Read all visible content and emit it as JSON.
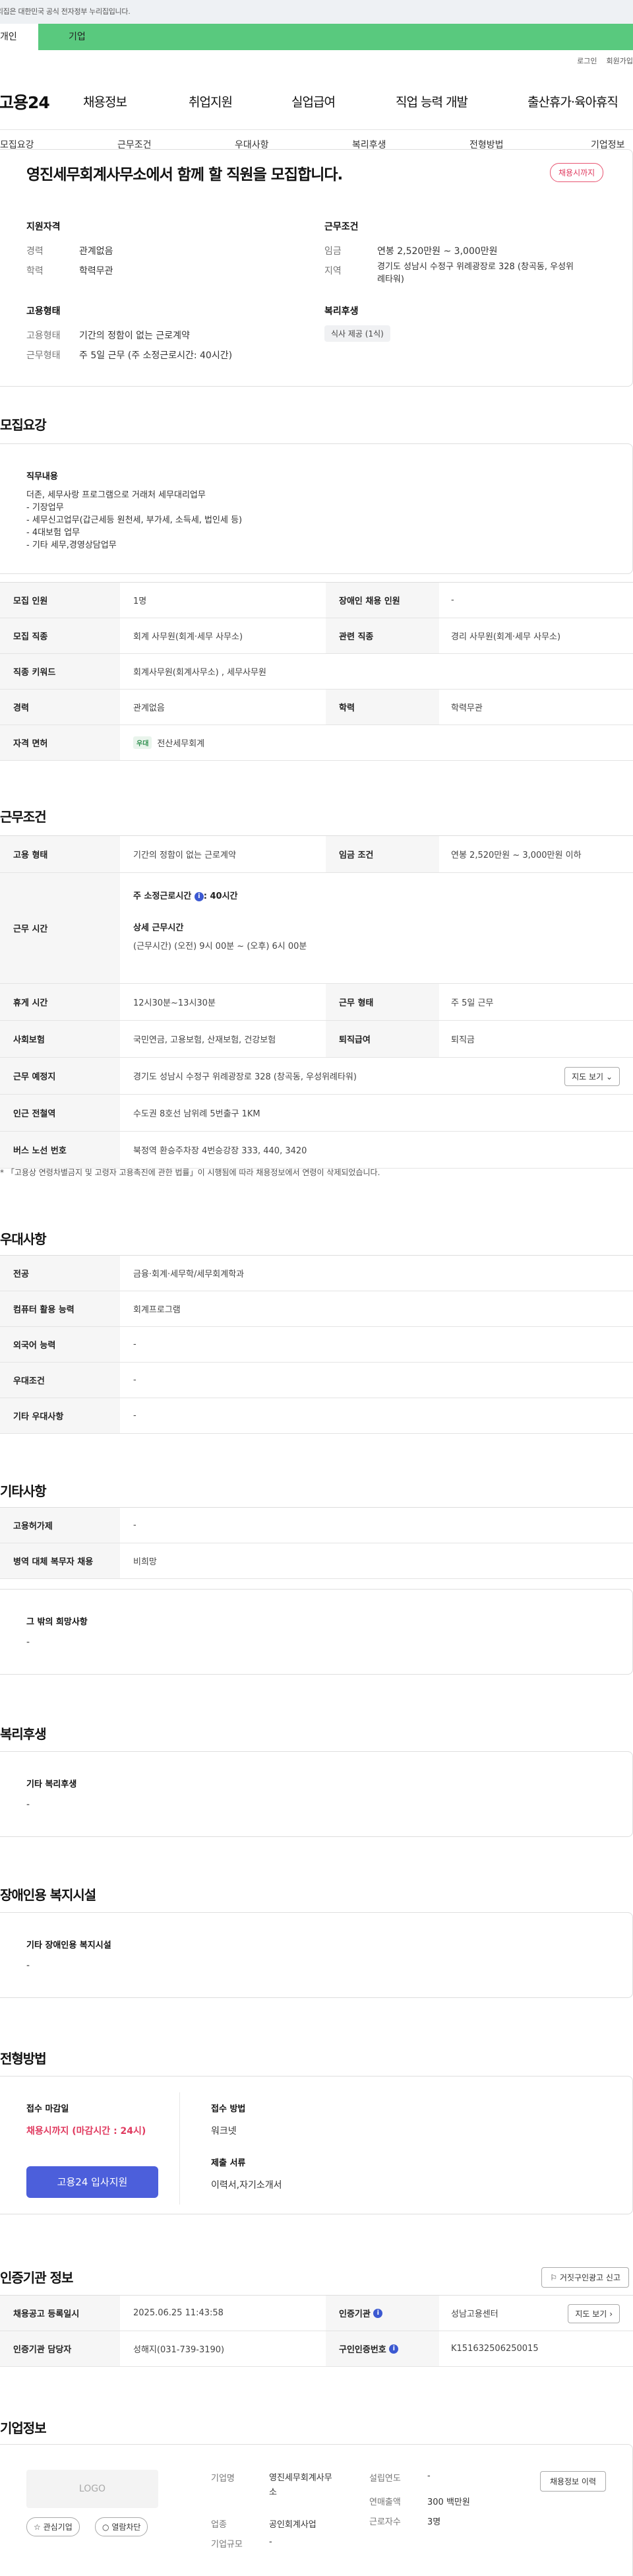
{
  "gov_banner": "이 누리집은 대한민국 공식 전자정부 누리집입니다.",
  "top_tabs": [
    "개인",
    "기업"
  ],
  "util": [
    "로그인",
    "회원가입"
  ],
  "logo": "고용24",
  "gnb": [
    "채용정보",
    "취업지원",
    "실업급여",
    "직업 능력 개발",
    "출산휴가·육아휴직"
  ],
  "secnav": [
    "모집요강",
    "근무조건",
    "우대사항",
    "복리후생",
    "전형방법",
    "기업정보"
  ],
  "summary": {
    "title": "영진세무회계사무소에서 함께 할 직원을 모집합니다.",
    "badge": "채용시까지",
    "qual_h": "지원자격",
    "exp_k": "경력",
    "exp_v": "관계없음",
    "edu_k": "학력",
    "edu_v": "학력무관",
    "emp_h": "고용형태",
    "emp_type_k": "고용형태",
    "emp_type_v": "기간의 정함이 없는 근로계약",
    "work_k": "근무형태",
    "work_v": "주 5일 근무 (주 소정근로시간: 40시간)",
    "cond_h": "근무조건",
    "wage_k": "임금",
    "wage_v": "연봉 2,520만원 ~ 3,000만원",
    "area_k": "지역",
    "area_v1": "경기도 성남시 수정구 위례광장로 328 (창곡동, 우성위",
    "area_v2": "례타워)",
    "welfare_h": "복리후생",
    "welfare_tag": "식사 제공 (1식)"
  },
  "req": {
    "title": "모집요강",
    "duty_h": "직무내용",
    "duty": [
      "더존, 세무사랑 프로그램으로 거래처 세무대리업무",
      "- 기장업무",
      "- 세무신고업무(갑근세등 원천세, 부가세, 소득세, 법인세 등)",
      "- 4대보험 업무",
      "- 기타 세무,경영상담업무"
    ],
    "rows": [
      {
        "k1": "모집 인원",
        "v1": "1명",
        "k2": "장애인 채용 인원",
        "v2": "-"
      },
      {
        "k1": "모집 직종",
        "v1": "회계 사무원(회계·세무 사무소)",
        "k2": "관련 직종",
        "v2": "경리 사무원(회계·세무 사무소)"
      },
      {
        "k1": "직종 키워드",
        "v1": "회계사무원(회계사무소) , 세무사무원"
      },
      {
        "k1": "경력",
        "v1": "관계없음",
        "k2": "학력",
        "v2": "학력무관"
      },
      {
        "k1": "자격 면허",
        "tag": "우대",
        "v1": "전산세무회계"
      }
    ]
  },
  "cond": {
    "title": "근무조건",
    "r1": {
      "k1": "고용 형태",
      "v1": "기간의 정함이 없는 근로계약",
      "k2": "임금 조건",
      "v2": "연봉 2,520만원 ~ 3,000만원 이하"
    },
    "r2": {
      "k": "근무 시간",
      "hours_k": "주 소정근로시간",
      "hours_v": ": 40시간",
      "detail_h": "상세 근무시간",
      "detail_v": "(근무시간) (오전) 9시 00분 ~ (오후) 6시 00분"
    },
    "r3": {
      "k1": "휴게 시간",
      "v1": "12시30분~13시30분",
      "k2": "근무 형태",
      "v2": "주 5일 근무"
    },
    "r4": {
      "k1": "사회보험",
      "v1": "국민연금, 고용보험, 산재보험, 건강보험",
      "k2": "퇴직급여",
      "v2": "퇴직금"
    },
    "r5": {
      "k": "근무 예정지",
      "v": "경기도 성남시 수정구 위례광장로 328 (창곡동, 우성위례타워)",
      "btn": "지도 보기"
    },
    "r6": {
      "k": "인근 전철역",
      "v": "수도권 8호선 남위례 5번출구 1KM"
    },
    "r7": {
      "k": "버스 노선 번호",
      "v": "북정역 환승주차장 4번승강장 333, 440, 3420"
    },
    "note": "* 「고용상 연령차별금지 및 고령자 고용촉진에 관한 법률」이 시행됨에 따라 채용정보에서 연령이 삭제되었습니다."
  },
  "pref": {
    "title": "우대사항",
    "rows": [
      {
        "k": "전공",
        "v": "금융·회계·세무학/세무회계학과"
      },
      {
        "k": "컴퓨터 활용 능력",
        "v": "회계프로그램"
      },
      {
        "k": "외국어 능력",
        "v": "-"
      },
      {
        "k": "우대조건",
        "v": "-"
      },
      {
        "k": "기타 우대사항",
        "v": "-"
      }
    ]
  },
  "etc": {
    "title": "기타사항",
    "rows": [
      {
        "k": "고용허가제",
        "v": "-"
      },
      {
        "k": "병역 대체 복무자 채용",
        "v": "비희망"
      }
    ],
    "box_h": "그 밖의 희망사항",
    "box_v": "-"
  },
  "welfare": {
    "title": "복리후생",
    "box_h": "기타 복리후생",
    "box_v": "-"
  },
  "disab": {
    "title": "장애인용 복지시설",
    "box_h": "기타 장애인용 복지시설",
    "box_v": "-"
  },
  "proc": {
    "title": "전형방법",
    "deadline_h": "접수 마감일",
    "deadline_v": "채용시까지 (마감시간 : 24시)",
    "apply_btn": "고용24 입사지원",
    "method_h": "접수 방법",
    "method_v": "워크넷",
    "docs_h": "제출 서류",
    "docs_v": "이력서,자기소개서"
  },
  "cert": {
    "title": "인증기관 정보",
    "report_btn": "거짓구인광고 신고",
    "r1": {
      "k1": "채용공고 등록일시",
      "v1": "2025.06.25 11:43:58",
      "k2": "인증기관",
      "v2": "성남고용센터",
      "btn": "지도 보기"
    },
    "r2": {
      "k1": "인증기관 담당자",
      "v1": "성해지(031-739-3190)",
      "k2": "구인인증번호",
      "v2": "K151632506250015"
    }
  },
  "company": {
    "title": "기업정보",
    "logo": "LOGO",
    "fav_btn": "관심기업",
    "block_btn": "열람차단",
    "name_k": "기업명",
    "name_v1": "영진세무회계사무",
    "name_v2": "소",
    "biz_k": "업종",
    "biz_v": "공인회계사업",
    "size_k": "기업규모",
    "size_v": "-",
    "est_k": "설립연도",
    "est_v": "-",
    "sales_k": "연매출액",
    "sales_v": "300 백만원",
    "emp_k": "근로자수",
    "emp_v": "3명",
    "info_btn": "채용정보 이력"
  }
}
